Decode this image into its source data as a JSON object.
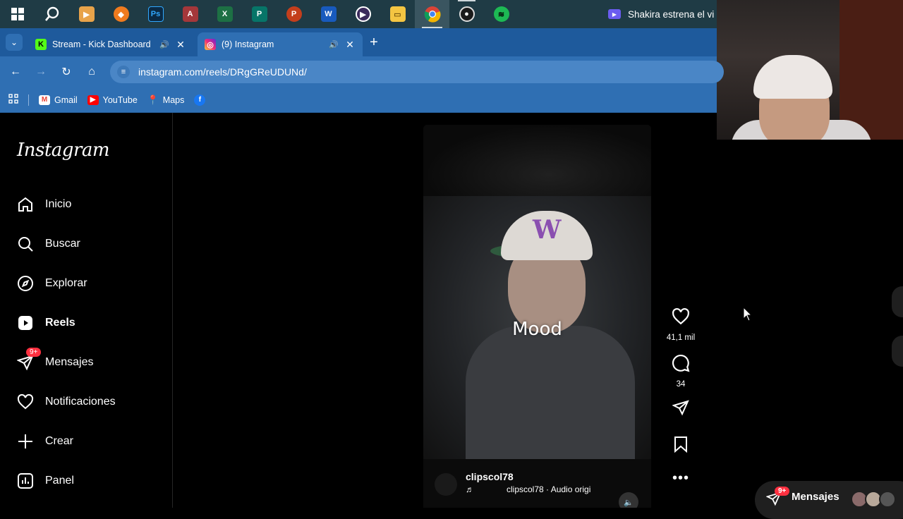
{
  "taskbar": {
    "apps": [
      {
        "name": "windows-start",
        "label": ""
      },
      {
        "name": "search",
        "label": ""
      },
      {
        "name": "media-player",
        "label": ""
      },
      {
        "name": "fl-studio",
        "label": ""
      },
      {
        "name": "photoshop",
        "label": "Ps"
      },
      {
        "name": "access",
        "label": "A"
      },
      {
        "name": "excel",
        "label": "X"
      },
      {
        "name": "publisher",
        "label": "P"
      },
      {
        "name": "powerpoint",
        "label": "P"
      },
      {
        "name": "word",
        "label": "W"
      },
      {
        "name": "clipchamp",
        "label": ""
      },
      {
        "name": "file-explorer",
        "label": ""
      },
      {
        "name": "chrome",
        "label": ""
      },
      {
        "name": "obs",
        "label": ""
      },
      {
        "name": "spotify",
        "label": ""
      }
    ],
    "news_text": "Shakira estrena el vi"
  },
  "browser": {
    "tabs": [
      {
        "title": "Stream - Kick Dashboard",
        "favicon": "K"
      },
      {
        "title": "(9) Instagram",
        "favicon": "ig"
      }
    ],
    "url": "instagram.com/reels/DRgGReUDUNd/",
    "bookmarks": [
      "Gmail",
      "YouTube",
      "Maps"
    ]
  },
  "instagram": {
    "logo": "Instagram",
    "nav": [
      {
        "label": "Inicio",
        "icon": "home-icon"
      },
      {
        "label": "Buscar",
        "icon": "search-icon"
      },
      {
        "label": "Explorar",
        "icon": "compass-icon"
      },
      {
        "label": "Reels",
        "icon": "reels-icon"
      },
      {
        "label": "Mensajes",
        "icon": "messenger-icon",
        "badge": "9+"
      },
      {
        "label": "Notificaciones",
        "icon": "heart-icon"
      },
      {
        "label": "Crear",
        "icon": "plus-icon"
      },
      {
        "label": "Panel",
        "icon": "dashboard-icon"
      }
    ],
    "reel": {
      "overlay_text": "Mood",
      "username": "clipscol78",
      "audio": "clipscol78 · Audio origi",
      "likes": "41,1 mil",
      "comments": "34"
    },
    "messages_pill": {
      "label": "Mensajes",
      "badge": "9+"
    }
  }
}
